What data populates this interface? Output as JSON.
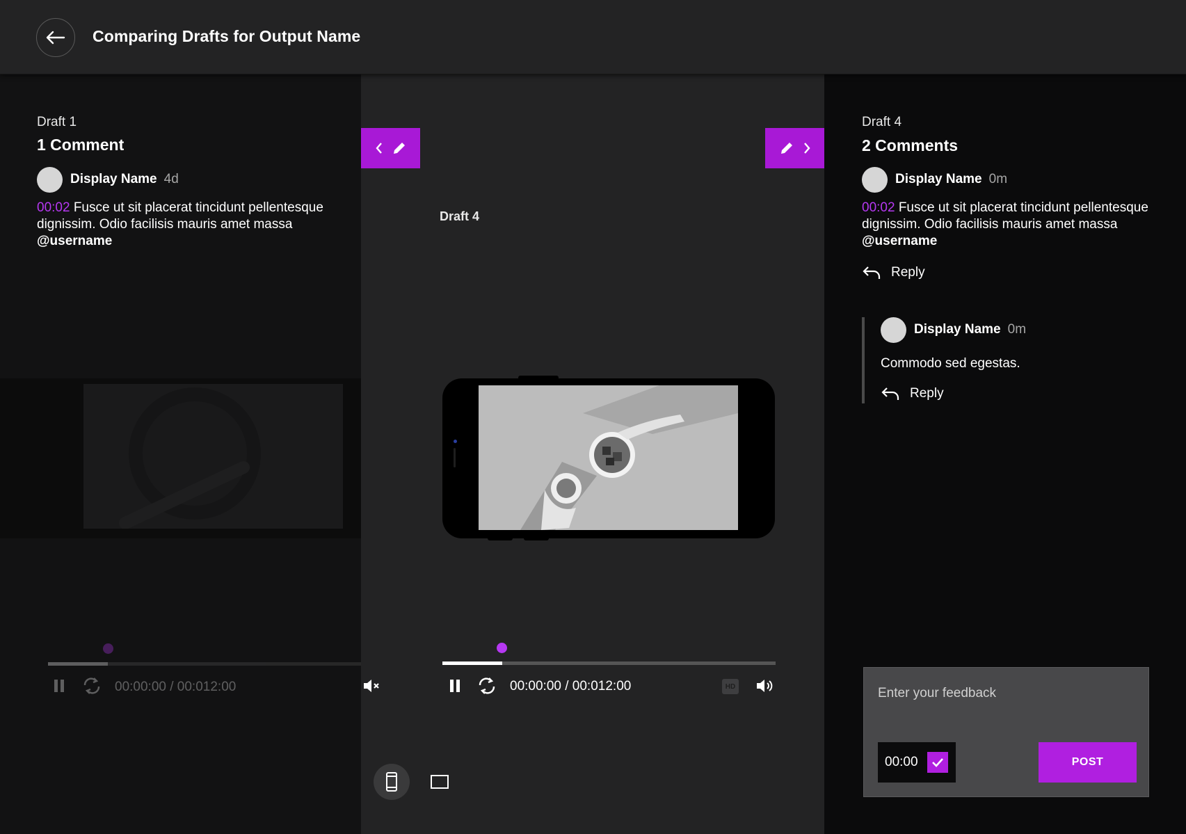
{
  "header": {
    "title": "Comparing Drafts for Output Name"
  },
  "left_panel": {
    "draft_label": "Draft 1",
    "comment_count": "1 Comment",
    "comments": [
      {
        "name": "Display Name",
        "time": "4d",
        "timestamp": "00:02",
        "text": " Fusce ut sit placerat tincidunt pellentesque dignissim. Odio facilisis mauris amet massa ",
        "mention": "@username"
      }
    ],
    "player": {
      "time_display": "00:00:00 / 00:012:00"
    }
  },
  "center": {
    "draft_label": "Draft 4",
    "player": {
      "time_display": "00:00:00 / 00:012:00",
      "progress": 0.18
    },
    "hd_label": "HD"
  },
  "right_panel": {
    "draft_label": "Draft 4",
    "comment_count": "2 Comments",
    "comments": [
      {
        "name": "Display Name",
        "time": "0m",
        "timestamp": "00:02",
        "text": " Fusce ut sit placerat tincidunt pellentesque dignissim. Odio facilisis mauris amet massa ",
        "mention": "@username",
        "reply_label": "Reply"
      }
    ],
    "reply": {
      "name": "Display Name",
      "time": "0m",
      "text": "Commodo sed egestas.",
      "reply_label": "Reply"
    }
  },
  "feedback": {
    "placeholder": "Enter your feedback",
    "timestamp": "00:00",
    "post_label": "POST"
  },
  "colors": {
    "accent": "#b01fe0",
    "timestamp": "#b638f2"
  }
}
